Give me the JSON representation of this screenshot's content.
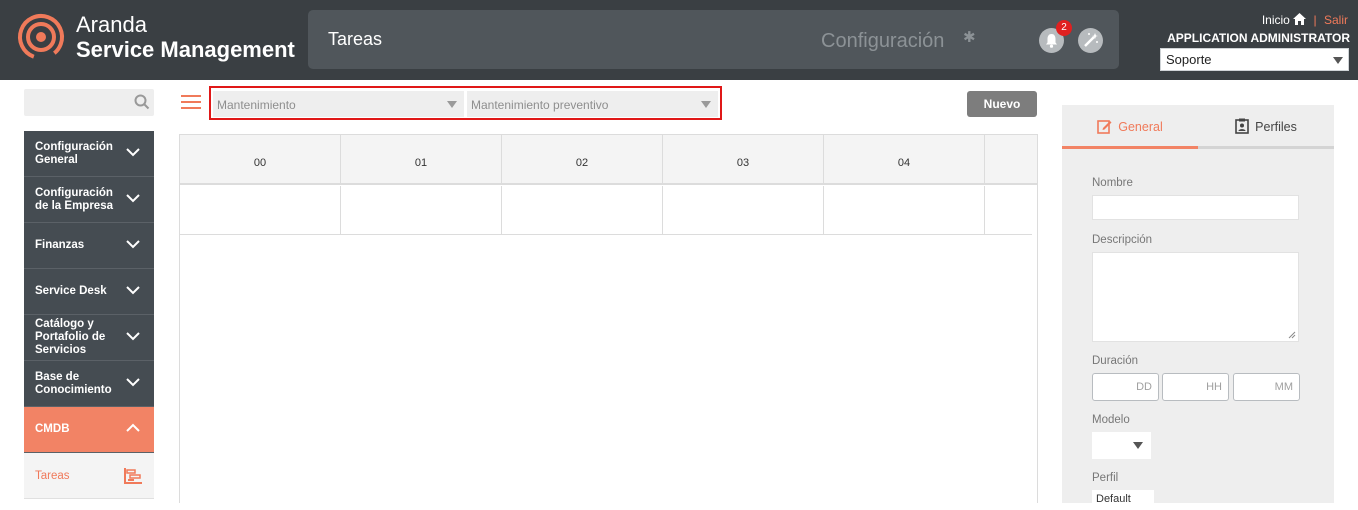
{
  "header": {
    "brand_line1": "Aranda",
    "brand_line2": "Service Management",
    "page_title": "Tareas",
    "config_link": "Configuración",
    "notification_count": "2",
    "home_link": "Inicio",
    "logout_link": "Salir",
    "user_name": "APPLICATION ADMINISTRATOR",
    "role_selected": "Soporte",
    "accent": "#f07a5a"
  },
  "sidebar": {
    "search_placeholder": "",
    "items": [
      {
        "label": "Configuración General"
      },
      {
        "label": "Configuración de la Empresa"
      },
      {
        "label": "Finanzas"
      },
      {
        "label": "Service Desk"
      },
      {
        "label": "Catálogo y Portafolio de Servicios"
      },
      {
        "label": "Base de Conocimiento"
      },
      {
        "label": "CMDB"
      }
    ],
    "sub_item": "Tareas"
  },
  "filters": {
    "type_selected": "Mantenimiento",
    "subtype_selected": "Mantenimiento preventivo",
    "new_button": "Nuevo"
  },
  "grid": {
    "columns": [
      "00",
      "01",
      "02",
      "03",
      "04"
    ]
  },
  "panel": {
    "tab_general": "General",
    "tab_profiles": "Perfiles",
    "name_label": "Nombre",
    "description_label": "Descripción",
    "duration_label": "Duración",
    "duration_days_placeholder": "DD",
    "duration_hours_placeholder": "HH",
    "duration_minutes_placeholder": "MM",
    "model_label": "Modelo",
    "profile_label": "Perfil",
    "profile_selected": "Default"
  }
}
